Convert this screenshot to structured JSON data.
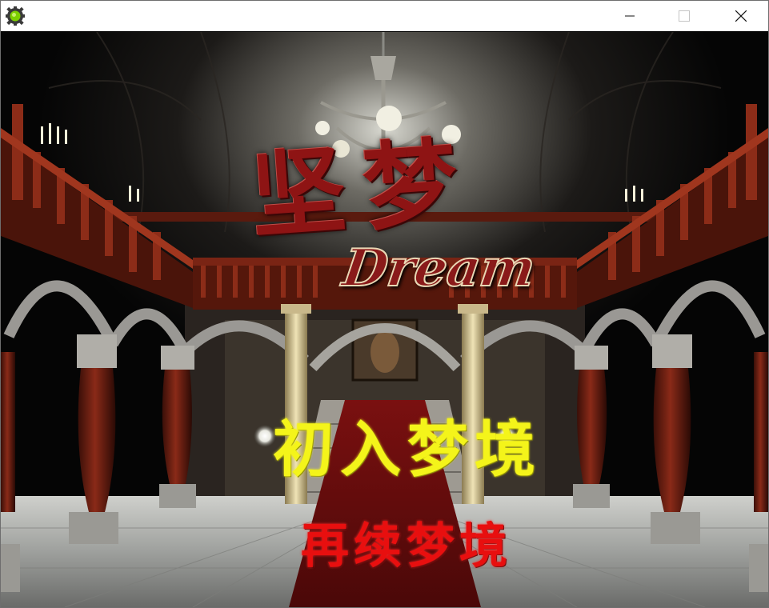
{
  "window": {
    "title": "",
    "app_icon": "gear-icon",
    "controls": {
      "minimize": "minimize-icon",
      "maximize": "maximize-icon",
      "close": "close-icon"
    }
  },
  "game": {
    "logo_chinese": "坚梦",
    "logo_english": "Dream",
    "menu": {
      "new_game": "初入梦境",
      "continue": "再续梦境"
    }
  },
  "colors": {
    "new_game_text": "#f4f41a",
    "continue_text": "#e80f0f",
    "logo_red": "#8e1414",
    "carpet": "#6b0d0d"
  }
}
